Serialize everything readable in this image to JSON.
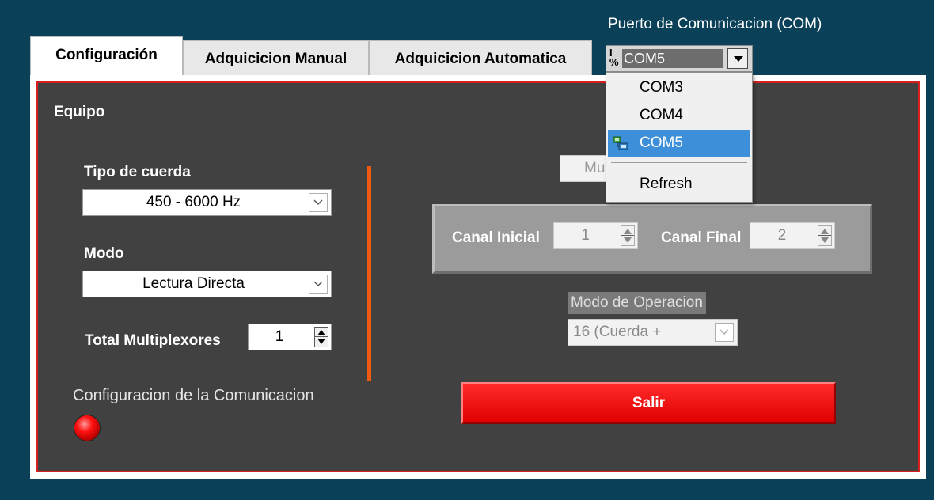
{
  "com": {
    "label": "Puerto de Comunicacion (COM)",
    "value": "COM5",
    "io_icon_top": "I",
    "io_icon_bottom": "%",
    "options": [
      "COM3",
      "COM4",
      "COM5"
    ],
    "selected": "COM5",
    "refresh": "Refresh"
  },
  "tabs": [
    {
      "label": "Configuración",
      "active": true
    },
    {
      "label": "Adquicicion Manual",
      "active": false
    },
    {
      "label": "Adquicicion Automatica",
      "active": false
    }
  ],
  "panel": {
    "section_title": "Equipo",
    "tipo_cuerda": {
      "label": "Tipo de cuerda",
      "value": "450 - 6000 Hz"
    },
    "modo": {
      "label": "Modo",
      "value": "Lectura Directa"
    },
    "total_multiplexores": {
      "label": "Total Multiplexores",
      "value": "1"
    },
    "mult_partial": "Mu",
    "canal_inicial": {
      "label": "Canal Inicial",
      "value": "1"
    },
    "canal_final": {
      "label": "Canal Final",
      "value": "2"
    },
    "modo_operacion": {
      "label": "Modo de Operacion",
      "value": "16 (Cuerda +"
    },
    "salir": "Salir",
    "config_comunicacion": "Configuracion de la Comunicacion"
  },
  "colors": {
    "background": "#0b4059",
    "panel": "#414141",
    "panel_border": "#d82020",
    "separator": "#f05a10",
    "salir_button": "#ff0000",
    "led": "#ff1010",
    "selected_option": "#3c8fd8"
  },
  "icons": [
    "io-icon",
    "dropdown-arrow-icon",
    "serial-port-icon",
    "spin-arrows-icon",
    "led-indicator-icon"
  ]
}
